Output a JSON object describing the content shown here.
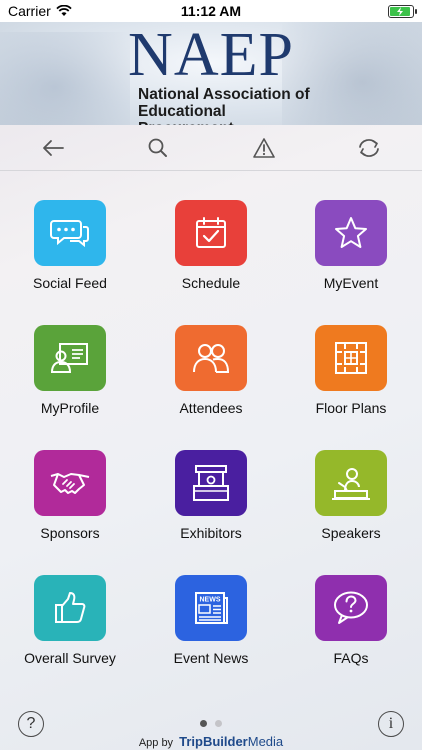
{
  "status_bar": {
    "carrier": "Carrier",
    "time": "11:12 AM",
    "battery_level": 0.9
  },
  "header": {
    "acronym": "NAEP",
    "subtitle_line1": "National Association of",
    "subtitle_line2": "Educational Procurement"
  },
  "toolbar": {
    "back_icon": "arrow-left-icon",
    "search_icon": "search-icon",
    "alert_icon": "warning-icon",
    "refresh_icon": "refresh-icon"
  },
  "tiles": [
    {
      "label": "Social Feed",
      "color": "#2fb6ec",
      "icon": "chat-bubbles-icon"
    },
    {
      "label": "Schedule",
      "color": "#e8403a",
      "icon": "calendar-check-icon"
    },
    {
      "label": "MyEvent",
      "color": "#8a4bbf",
      "icon": "star-icon"
    },
    {
      "label": "MyProfile",
      "color": "#5aa33a",
      "icon": "id-card-icon"
    },
    {
      "label": "Attendees",
      "color": "#ef6b30",
      "icon": "people-icon"
    },
    {
      "label": "Floor Plans",
      "color": "#ef7a1f",
      "icon": "floor-plan-icon"
    },
    {
      "label": "Sponsors",
      "color": "#b12a9a",
      "icon": "handshake-icon"
    },
    {
      "label": "Exhibitors",
      "color": "#4a1fa0",
      "icon": "booth-icon"
    },
    {
      "label": "Speakers",
      "color": "#95b82a",
      "icon": "podium-speaker-icon"
    },
    {
      "label": "Overall Survey",
      "color": "#29b3b8",
      "icon": "thumbs-up-icon"
    },
    {
      "label": "Event News",
      "color": "#2c63e0",
      "icon": "newspaper-icon"
    },
    {
      "label": "FAQs",
      "color": "#8f2fae",
      "icon": "question-bubble-icon"
    }
  ],
  "footer": {
    "help_symbol": "?",
    "info_symbol": "i",
    "page_count": 2,
    "active_page": 1,
    "credit_prefix": "App by",
    "credit_brand_a": "TripBuilder",
    "credit_brand_b": "Media"
  }
}
